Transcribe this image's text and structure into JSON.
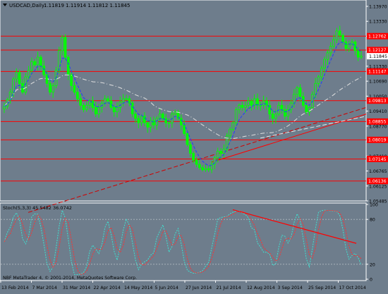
{
  "header": {
    "symbol": "USDCAD,Daily",
    "ohlc": "1.11819 1.11914 1.11812 1.11845"
  },
  "stoch_header": "Stoch(5,3,3) 45.5482 36.0742",
  "copyright": "NBF MetaTrader 4, © 2001-2014, MetaQuotes Software Corp.",
  "price_axis": {
    "ticks": [
      "1.13970",
      "1.13330",
      "1.12690",
      "1.12050",
      "1.11330",
      "1.10690",
      "1.10050",
      "1.09410",
      "1.08770",
      "1.08050",
      "1.07410",
      "1.06765",
      "1.06125",
      "1.05485"
    ],
    "current_price": "1.11845",
    "level_labels": [
      "1.12762",
      "1.12127",
      "1.11147",
      "1.09813",
      "1.08855",
      "1.08019",
      "1.07145",
      "1.06136"
    ]
  },
  "stoch_axis": {
    "ticks": [
      "100",
      "80",
      "20",
      "0"
    ]
  },
  "time_axis": {
    "labels": [
      "13 Feb 2014",
      "7 Mar 2014",
      "31 Mar 2014",
      "22 Apr 2014",
      "14 May 2014",
      "5 Jun 2014",
      "27 Jun 2014",
      "21 Jul 2014",
      "12 Aug 2014",
      "3 Sep 2014",
      "25 Sep 2014",
      "17 Oct 2014"
    ]
  },
  "colors": {
    "background": "#6e7d8c",
    "candle": "#00ff00",
    "level_line": "#ff0000",
    "trend_dashed": "#d00000",
    "ma_fast": "#1f3fff",
    "ma_slow": "#e0e0e0",
    "stoch_main": "#40e0d0",
    "stoch_signal": "#ff3030"
  },
  "chart_data": {
    "type": "candlestick",
    "title": "USDCAD,Daily",
    "y_range": [
      1.0529,
      1.1435
    ],
    "current_price": 1.11845,
    "horizontal_levels": [
      1.12762,
      1.12127,
      1.11147,
      1.09813,
      1.08855,
      1.08019,
      1.07145,
      1.06136
    ],
    "closes": [
      1.0955,
      1.0985,
      1.102,
      1.108,
      1.111,
      1.106,
      1.102,
      1.109,
      1.112,
      1.116,
      1.1145,
      1.118,
      1.114,
      1.11,
      1.106,
      1.102,
      1.105,
      1.112,
      1.121,
      1.127,
      1.118,
      1.11,
      1.105,
      1.102,
      1.099,
      1.096,
      1.094,
      1.096,
      1.098,
      1.095,
      1.092,
      1.095,
      1.097,
      1.099,
      1.098,
      1.095,
      1.093,
      1.095,
      1.0975,
      1.099,
      1.099,
      1.097,
      1.092,
      1.09,
      1.088,
      1.091,
      1.088,
      1.086,
      1.089,
      1.087,
      1.09,
      1.092,
      1.09,
      1.088,
      1.088,
      1.092,
      1.093,
      1.09,
      1.087,
      1.083,
      1.078,
      1.074,
      1.071,
      1.069,
      1.0675,
      1.0665,
      1.067,
      1.0665,
      1.069,
      1.072,
      1.075,
      1.074,
      1.076,
      1.082,
      1.085,
      1.088,
      1.094,
      1.096,
      1.095,
      1.096,
      1.098,
      1.096,
      1.099,
      1.096,
      1.096,
      1.098,
      1.096,
      1.092,
      1.09,
      1.092,
      1.096,
      1.094,
      1.091,
      1.094,
      1.097,
      1.101,
      1.104,
      1.1,
      1.096,
      1.093,
      1.095,
      1.101,
      1.106,
      1.109,
      1.113,
      1.117,
      1.12,
      1.123,
      1.126,
      1.13,
      1.128,
      1.125,
      1.122,
      1.124,
      1.125,
      1.121,
      1.118,
      1.1185
    ],
    "stochastic": {
      "k": 45.5482,
      "d": 36.0742,
      "levels": [
        80,
        20
      ]
    }
  }
}
